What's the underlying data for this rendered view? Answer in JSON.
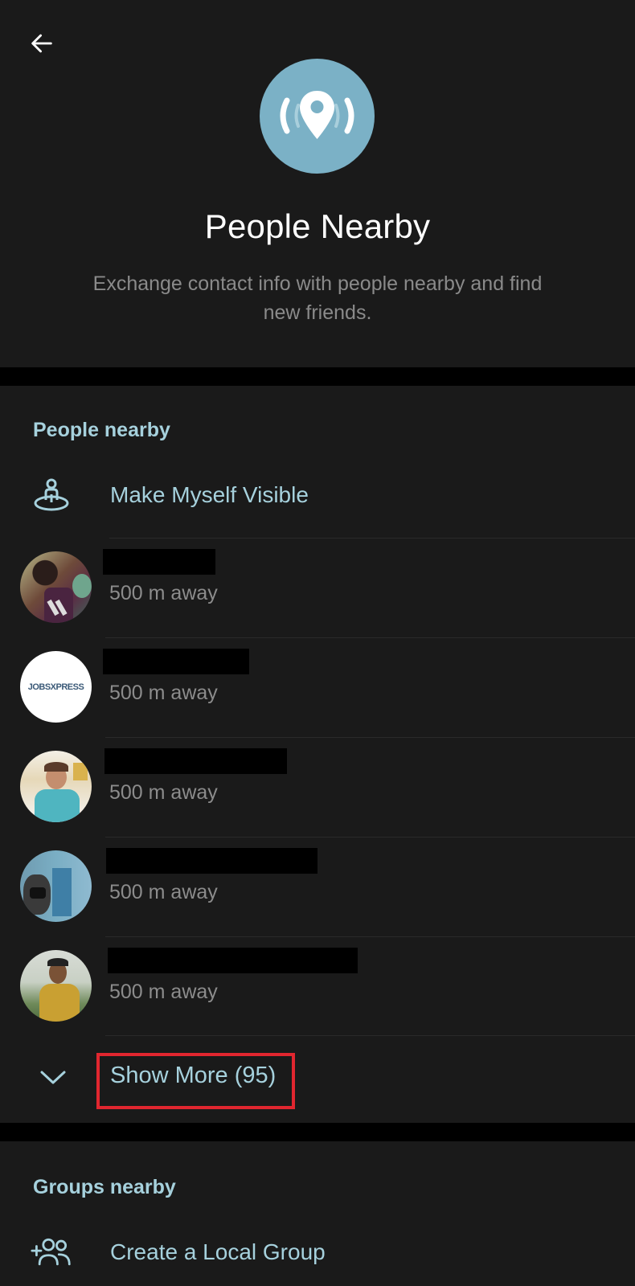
{
  "header": {
    "back_icon": "arrow-left-icon",
    "hero_icon": "location-broadcast-icon",
    "title": "People Nearby",
    "subtitle": "Exchange contact info with people nearby and find new friends."
  },
  "colors": {
    "accent": "#a6d1dd",
    "hero_circle": "#7bb1c6",
    "background": "#1a1a1a",
    "section_gap": "#000000",
    "secondary_text": "#8c8c8c",
    "highlight": "#e1262f"
  },
  "people_section": {
    "title": "People nearby",
    "action": {
      "icon": "person-visible-icon",
      "label": "Make Myself Visible"
    },
    "people": [
      {
        "name": "[redacted]",
        "distance": "500 m away",
        "avatar": "photo-man-bearded"
      },
      {
        "name": "[redacted]",
        "distance": "500 m away",
        "avatar": "logo-jobsxpress",
        "avatar_text": "JOBSXPRESS"
      },
      {
        "name": "[redacted]",
        "distance": "500 m away",
        "avatar": "photo-man-floral-shirt"
      },
      {
        "name": "[redacted]",
        "distance": "500 m away",
        "avatar": "photo-masked-person"
      },
      {
        "name": "[redacted]",
        "distance": "500 m away",
        "avatar": "photo-man-yellow-shirt"
      }
    ],
    "show_more": {
      "icon": "chevron-down-icon",
      "label": "Show More (95)",
      "count": 95
    }
  },
  "groups_section": {
    "title": "Groups nearby",
    "action": {
      "icon": "add-group-icon",
      "label": "Create a Local Group"
    }
  }
}
